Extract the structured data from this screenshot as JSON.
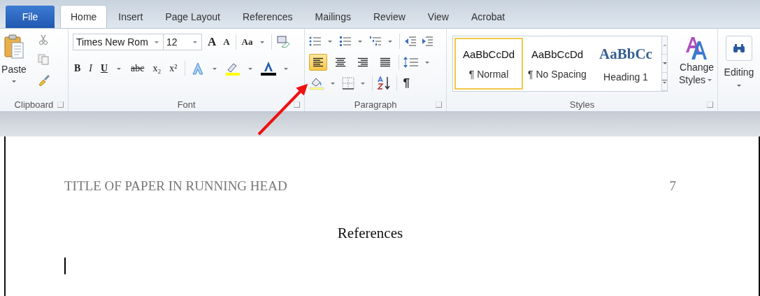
{
  "tabs": [
    {
      "label": "File",
      "kind": "file",
      "selected": false
    },
    {
      "label": "Home",
      "kind": "tab",
      "selected": true
    },
    {
      "label": "Insert",
      "kind": "tab",
      "selected": false
    },
    {
      "label": "Page Layout",
      "kind": "tab",
      "selected": false
    },
    {
      "label": "References",
      "kind": "tab",
      "selected": false
    },
    {
      "label": "Mailings",
      "kind": "tab",
      "selected": false
    },
    {
      "label": "Review",
      "kind": "tab",
      "selected": false
    },
    {
      "label": "View",
      "kind": "tab",
      "selected": false
    },
    {
      "label": "Acrobat",
      "kind": "tab",
      "selected": false
    }
  ],
  "clipboard": {
    "paste_label": "Paste",
    "group_label": "Clipboard"
  },
  "font": {
    "font_name": "Times New Rom",
    "font_size": "12",
    "grow": "A",
    "shrink": "A",
    "change_case": "Aa",
    "format_buttons": [
      {
        "label": "B",
        "kind": "bold"
      },
      {
        "label": "I",
        "kind": "italic"
      },
      {
        "label": "U",
        "kind": "underline"
      },
      {
        "label": "abc",
        "kind": "strike"
      },
      {
        "label": "x₂",
        "kind": "plain"
      },
      {
        "label": "x²",
        "kind": "plain"
      }
    ],
    "group_label": "Font"
  },
  "paragraph": {
    "align_buttons": [
      {
        "selected": true
      },
      {
        "selected": false
      },
      {
        "selected": false
      },
      {
        "selected": false
      }
    ],
    "pilcrow": "¶",
    "group_label": "Paragraph"
  },
  "styles": {
    "gallery": [
      {
        "sample": "AaBbCcDd",
        "name": "¶ Normal",
        "kind": "body",
        "selected": true
      },
      {
        "sample": "AaBbCcDd",
        "name": "¶ No Spacing",
        "kind": "body",
        "selected": false
      },
      {
        "sample": "AaBbCc",
        "name": "Heading 1",
        "kind": "heading",
        "selected": false
      }
    ],
    "change_styles": [
      "Change",
      "Styles"
    ],
    "group_label": "Styles"
  },
  "editing": {
    "label": "Editing"
  },
  "document": {
    "running_head": "TITLE OF PAPER IN RUNNING HEAD",
    "page_number": "7",
    "heading": "References"
  }
}
